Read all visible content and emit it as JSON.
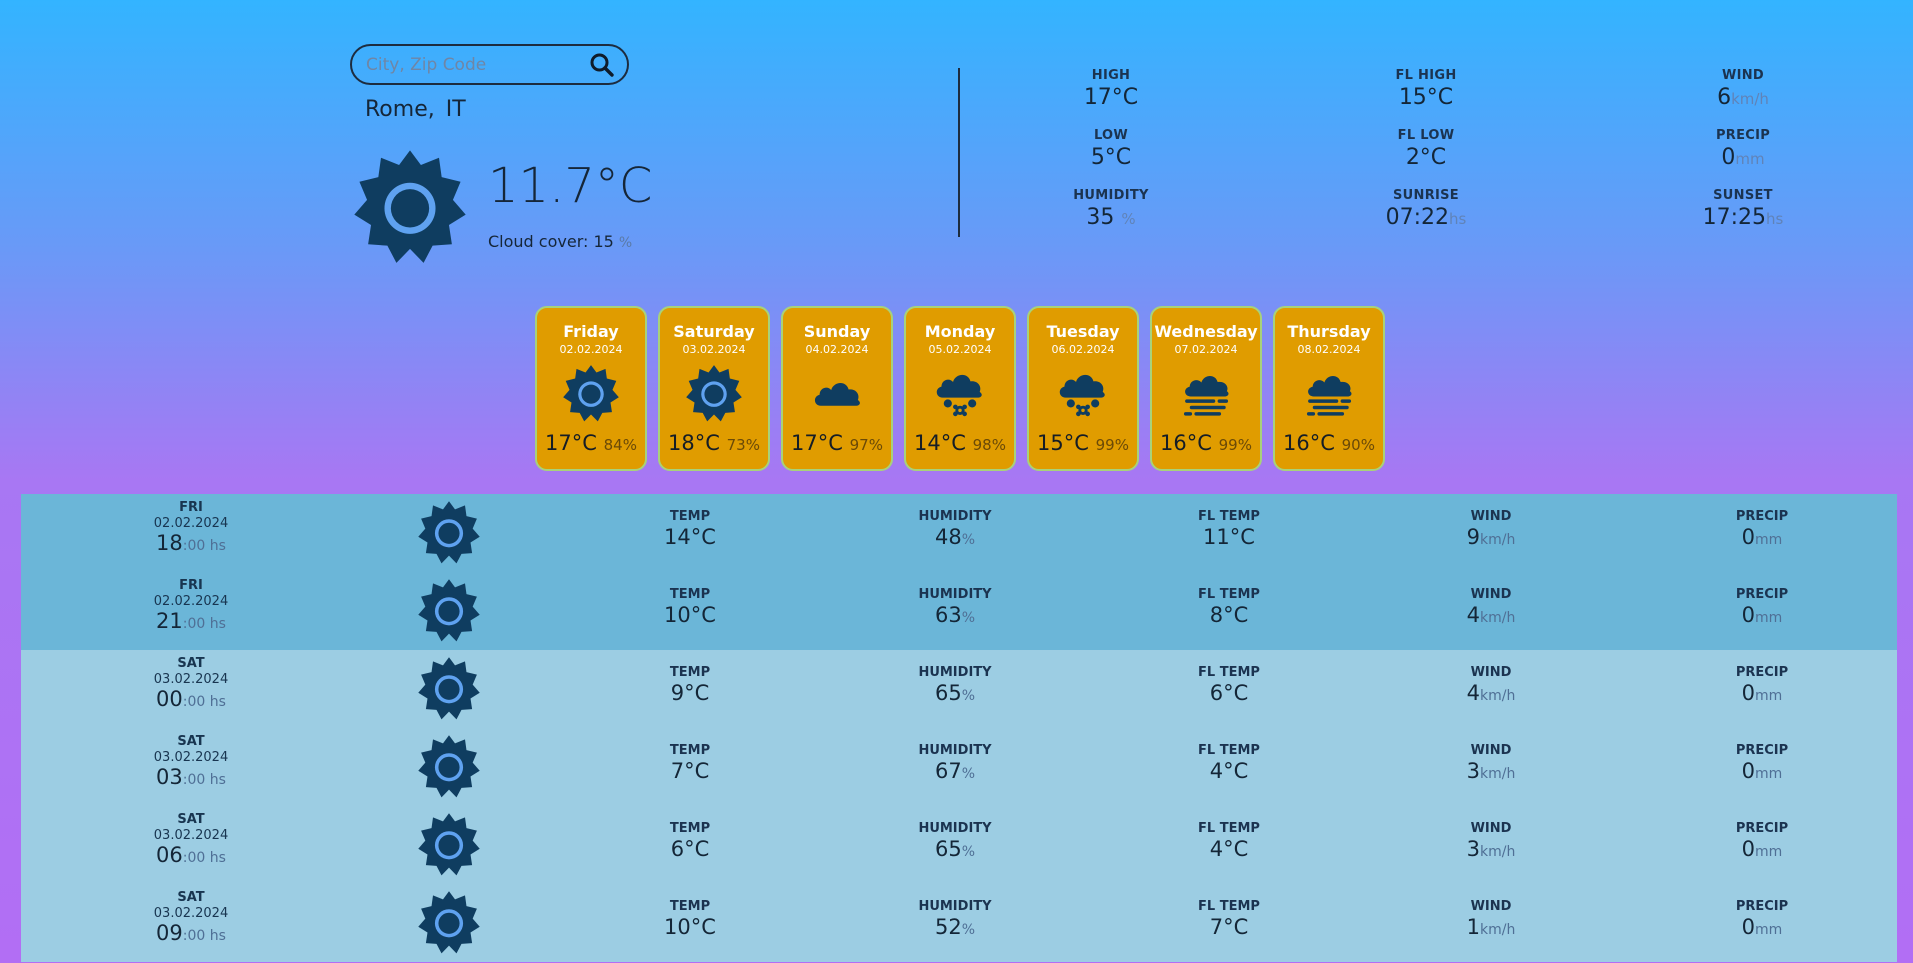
{
  "search": {
    "placeholder": "City, Zip Code"
  },
  "location": {
    "city": "Rome,",
    "country": "IT"
  },
  "current": {
    "temp": "11.7°C",
    "cloud_cover_label": "Cloud cover:",
    "cloud_cover_value": "15",
    "cloud_cover_unit": "%",
    "icon": "sun-icon"
  },
  "stats": {
    "high": {
      "label": "HIGH",
      "value": "17°C"
    },
    "fl_high": {
      "label": "FL HIGH",
      "value": "15°C"
    },
    "wind": {
      "label": "WIND",
      "value": "6",
      "unit": "km/h"
    },
    "low": {
      "label": "LOW",
      "value": "5°C"
    },
    "fl_low": {
      "label": "FL LOW",
      "value": "2°C"
    },
    "precip": {
      "label": "PRECIP",
      "value": "0",
      "unit": "mm"
    },
    "humidity": {
      "label": "HUMIDITY",
      "value": "35",
      "unit": "%"
    },
    "sunrise": {
      "label": "SUNRISE",
      "value": "07:22",
      "unit": "hs"
    },
    "sunset": {
      "label": "SUNSET",
      "value": "17:25",
      "unit": "hs"
    }
  },
  "daily": [
    {
      "day": "Friday",
      "date": "02.02.2024",
      "temp": "17°C",
      "humidity": "84%",
      "icon": "sun-icon"
    },
    {
      "day": "Saturday",
      "date": "03.02.2024",
      "temp": "18°C",
      "humidity": "73%",
      "icon": "sun-icon"
    },
    {
      "day": "Sunday",
      "date": "04.02.2024",
      "temp": "17°C",
      "humidity": "97%",
      "icon": "cloud-icon"
    },
    {
      "day": "Monday",
      "date": "05.02.2024",
      "temp": "14°C",
      "humidity": "98%",
      "icon": "snow-cloud-icon"
    },
    {
      "day": "Tuesday",
      "date": "06.02.2024",
      "temp": "15°C",
      "humidity": "99%",
      "icon": "snow-cloud-icon"
    },
    {
      "day": "Wednesday",
      "date": "07.02.2024",
      "temp": "16°C",
      "humidity": "99%",
      "icon": "fog-icon"
    },
    {
      "day": "Thursday",
      "date": "08.02.2024",
      "temp": "16°C",
      "humidity": "90%",
      "icon": "fog-icon"
    }
  ],
  "hourly_labels": {
    "temp": "TEMP",
    "humidity": "HUMIDITY",
    "fl_temp": "FL TEMP",
    "wind": "WIND",
    "precip": "PRECIP",
    "minutes": ":00 hs",
    "humidity_unit": "%",
    "wind_unit": "km/h",
    "precip_unit": "mm"
  },
  "hourly": [
    {
      "day": "FRI",
      "date": "02.02.2024",
      "hour": "18",
      "temp": "14°C",
      "humidity": "48",
      "fl_temp": "11°C",
      "wind": "9",
      "precip": "0",
      "icon": "sun-icon"
    },
    {
      "day": "FRI",
      "date": "02.02.2024",
      "hour": "21",
      "temp": "10°C",
      "humidity": "63",
      "fl_temp": "8°C",
      "wind": "4",
      "precip": "0",
      "icon": "sun-icon"
    },
    {
      "day": "SAT",
      "date": "03.02.2024",
      "hour": "00",
      "temp": "9°C",
      "humidity": "65",
      "fl_temp": "6°C",
      "wind": "4",
      "precip": "0",
      "icon": "sun-icon"
    },
    {
      "day": "SAT",
      "date": "03.02.2024",
      "hour": "03",
      "temp": "7°C",
      "humidity": "67",
      "fl_temp": "4°C",
      "wind": "3",
      "precip": "0",
      "icon": "sun-icon"
    },
    {
      "day": "SAT",
      "date": "03.02.2024",
      "hour": "06",
      "temp": "6°C",
      "humidity": "65",
      "fl_temp": "4°C",
      "wind": "3",
      "precip": "0",
      "icon": "sun-icon"
    },
    {
      "day": "SAT",
      "date": "03.02.2024",
      "hour": "09",
      "temp": "10°C",
      "humidity": "52",
      "fl_temp": "7°C",
      "wind": "1",
      "precip": "0",
      "icon": "sun-icon"
    }
  ],
  "colors": {
    "icon": "#0f3d60",
    "icon_inner": "#5fa2f0",
    "card_bg": "#e09c00",
    "row_today": "#6bb6d8",
    "row_later": "#9ccde3"
  }
}
